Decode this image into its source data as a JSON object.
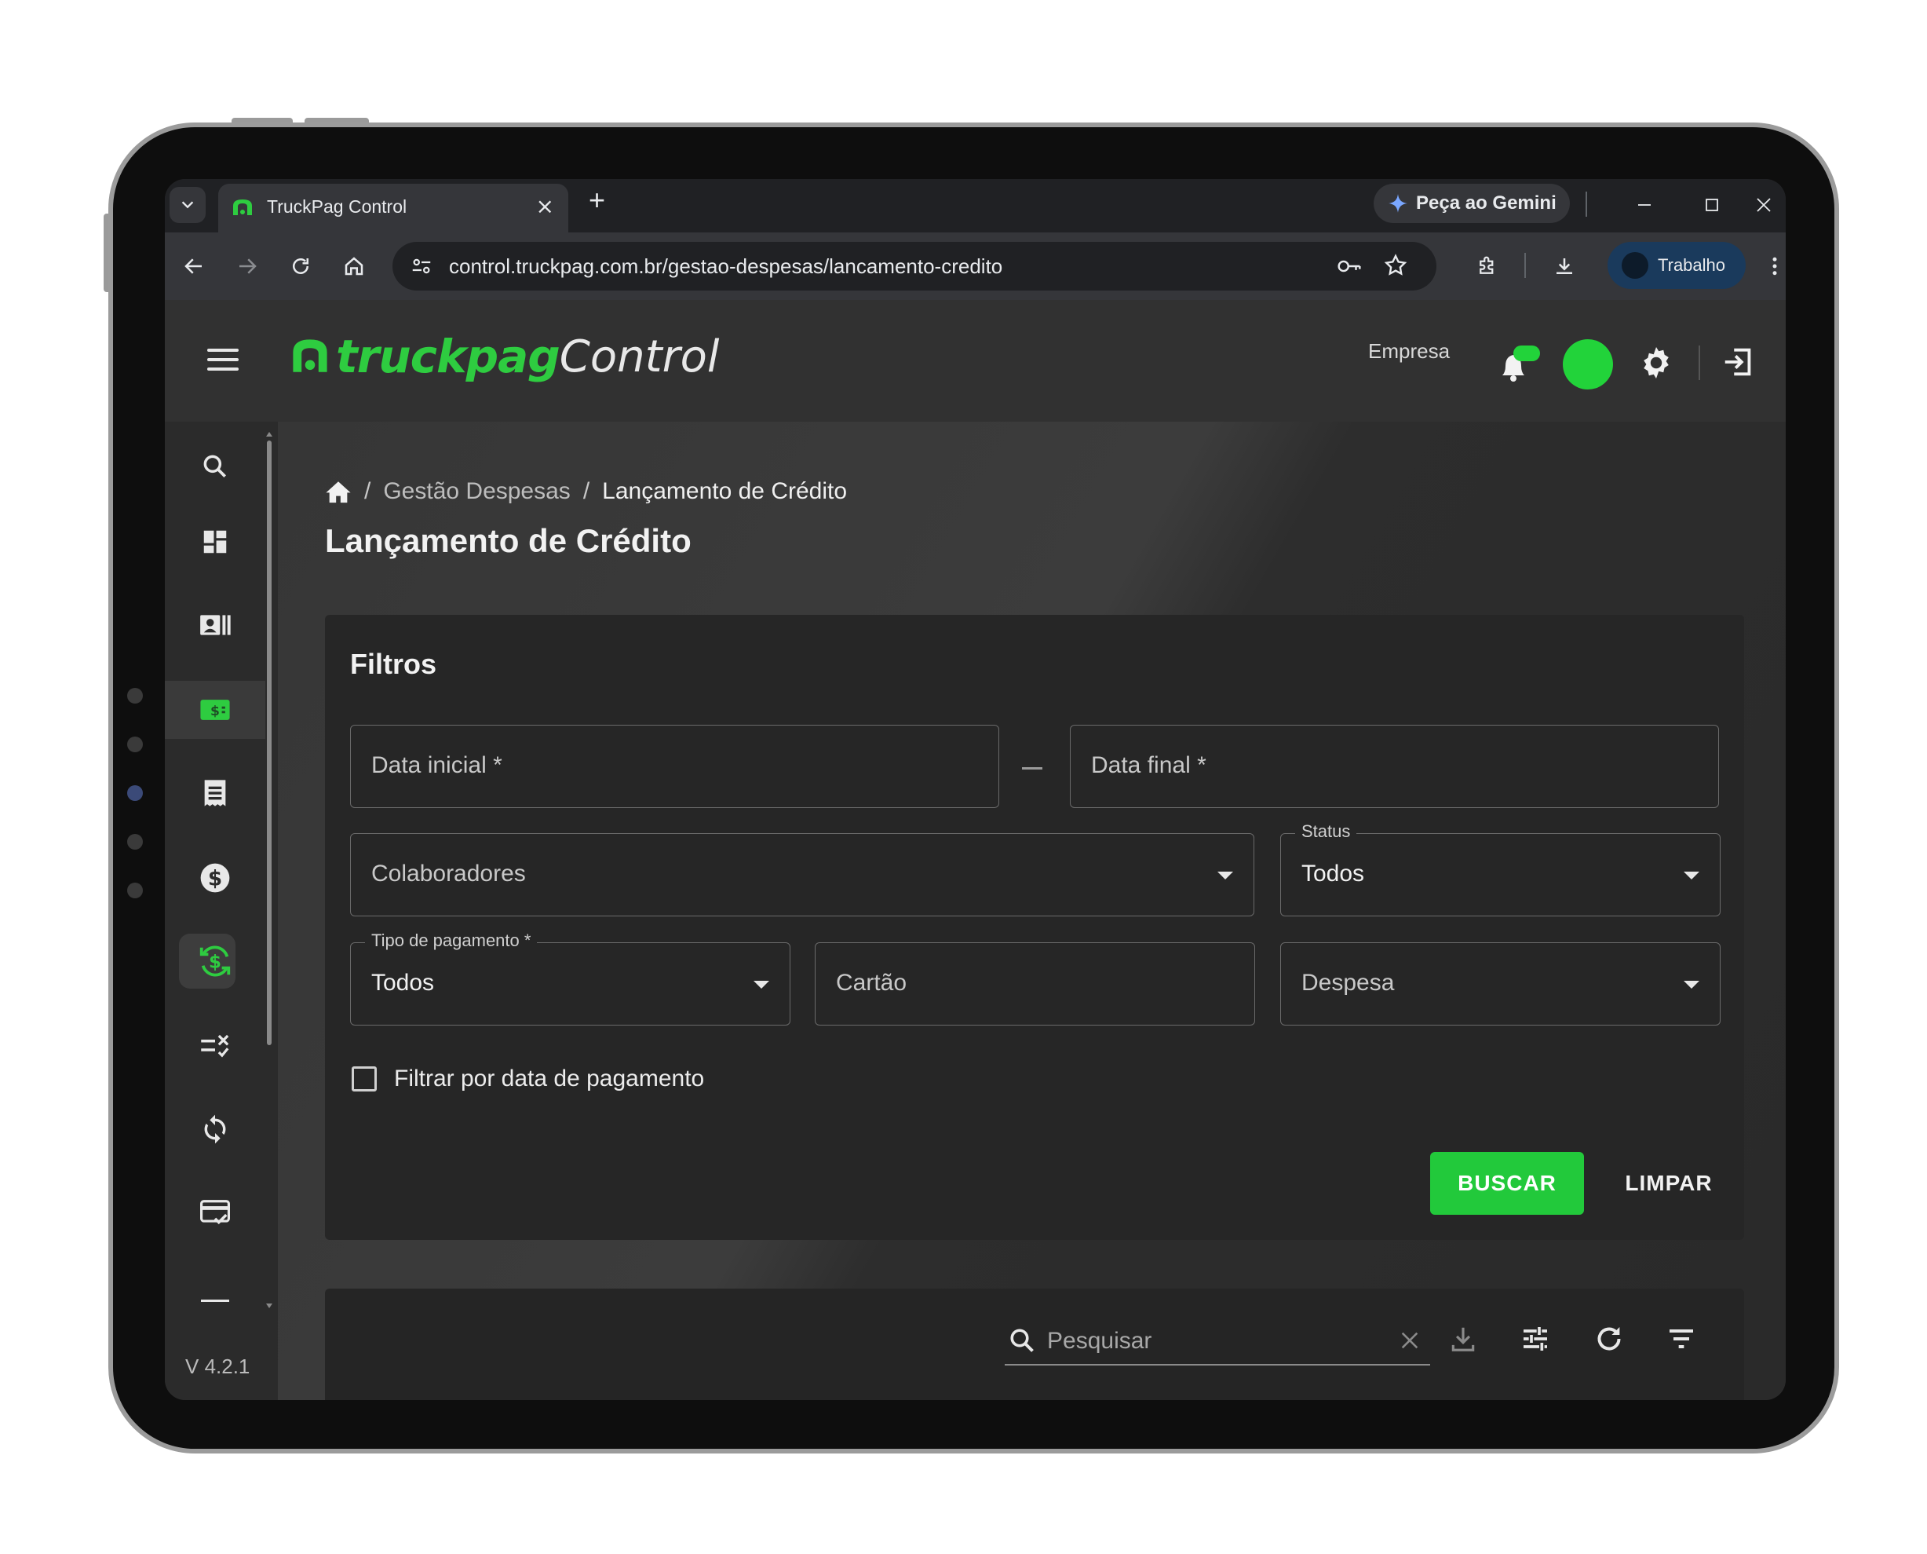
{
  "browser": {
    "tab_title": "TruckPag Control",
    "new_tab_symbol": "+",
    "gemini_label": "Peça ao Gemini",
    "url": "control.truckpag.com.br/gestao-despesas/lancamento-credito",
    "profile_label": "Trabalho"
  },
  "header": {
    "brand": "truckpag",
    "product": "Control",
    "company_label": "Empresa"
  },
  "sidebar": {
    "items": [
      "search-icon",
      "dashboard-icon",
      "contacts-icon",
      "money-icon",
      "receipt-icon",
      "dollar-icon",
      "credit-icon",
      "rules-icon",
      "sync-icon",
      "card-check-icon"
    ],
    "version": "V 4.2.1"
  },
  "breadcrumb": {
    "separator": "/",
    "section": "Gestão Despesas",
    "current": "Lançamento de Crédito"
  },
  "page": {
    "title": "Lançamento de Crédito"
  },
  "filters": {
    "title": "Filtros",
    "data_inicial": "Data inicial *",
    "data_final": "Data final *",
    "colaboradores": "Colaboradores",
    "status_label": "Status",
    "status_value": "Todos",
    "tipo_pagamento_label": "Tipo de pagamento *",
    "tipo_pagamento_value": "Todos",
    "cartao": "Cartão",
    "despesa": "Despesa",
    "checkbox_label": "Filtrar por data de pagamento",
    "search_button": "BUSCAR",
    "clear_button": "LIMPAR"
  },
  "table_toolbar": {
    "search_placeholder": "Pesquisar"
  },
  "colors": {
    "accent": "#22c93b",
    "status_dot": "#22d33a",
    "brand_green": "#2ecc40"
  }
}
